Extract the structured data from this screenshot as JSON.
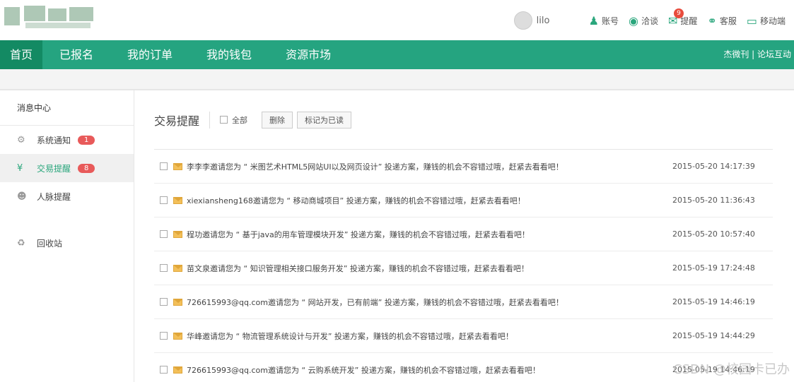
{
  "header": {
    "username": "lilo",
    "links": [
      {
        "icon": "user-icon",
        "label": "账号"
      },
      {
        "icon": "chat-icon",
        "label": "洽谈"
      },
      {
        "icon": "mail-icon",
        "label": "提醒",
        "badge": "9"
      },
      {
        "icon": "headset-icon",
        "label": "客服"
      },
      {
        "icon": "mobile-icon",
        "label": "移动端"
      }
    ]
  },
  "nav": {
    "tabs": [
      "首页",
      "已报名",
      "我的订单",
      "我的钱包",
      "资源市场"
    ],
    "active": "首页",
    "right_links": "杰微刊 | 论坛互动"
  },
  "sidebar": {
    "title": "消息中心",
    "items": [
      {
        "icon": "gear-icon",
        "label": "系统通知",
        "count": "1"
      },
      {
        "icon": "yen-icon",
        "label": "交易提醒",
        "count": "8",
        "active": true
      },
      {
        "icon": "contacts-icon",
        "label": "人脉提醒"
      },
      {
        "icon": "trash-icon",
        "label": "回收站"
      }
    ]
  },
  "main": {
    "title": "交易提醒",
    "select_all": "全部",
    "delete_btn": "删除",
    "mark_read_btn": "标记为已读",
    "rows": [
      {
        "msg": "李李李邀请您为 “ 米图艺术HTML5网站UI以及网页设计” 投递方案，赚钱的机会不容错过哦，赶紧去看看吧！",
        "time": "2015-05-20 14:17:39"
      },
      {
        "msg": "xiexiansheng168邀请您为 “ 移动商城项目” 投递方案，赚钱的机会不容错过哦，赶紧去看看吧！",
        "time": "2015-05-20 11:36:43"
      },
      {
        "msg": "程功邀请您为 “ 基于java的用车管理模块开发” 投递方案，赚钱的机会不容错过哦，赶紧去看看吧！",
        "time": "2015-05-20 10:57:40"
      },
      {
        "msg": "苗文泉邀请您为 “ 知识管理相关接口服务开发” 投递方案，赚钱的机会不容错过哦，赶紧去看看吧！",
        "time": "2015-05-19 17:24:48"
      },
      {
        "msg": "726615993@qq.com邀请您为 “ 网站开发，已有前端” 投递方案，赚钱的机会不容错过哦，赶紧去看看吧！",
        "time": "2015-05-19 14:46:19"
      },
      {
        "msg": "华峰邀请您为 “ 物流管理系统设计与开发” 投递方案，赚钱的机会不容错过哦，赶紧去看看吧！",
        "time": "2015-05-19 14:44:29"
      },
      {
        "msg": "726615993@qq.com邀请您为 “ 云购系统开发” 投递方案，赚钱的机会不容错过哦，赶紧去看看吧！",
        "time": "2015-05-19 14:46:19"
      }
    ]
  },
  "watermark": "CSDN @校园卡已办"
}
